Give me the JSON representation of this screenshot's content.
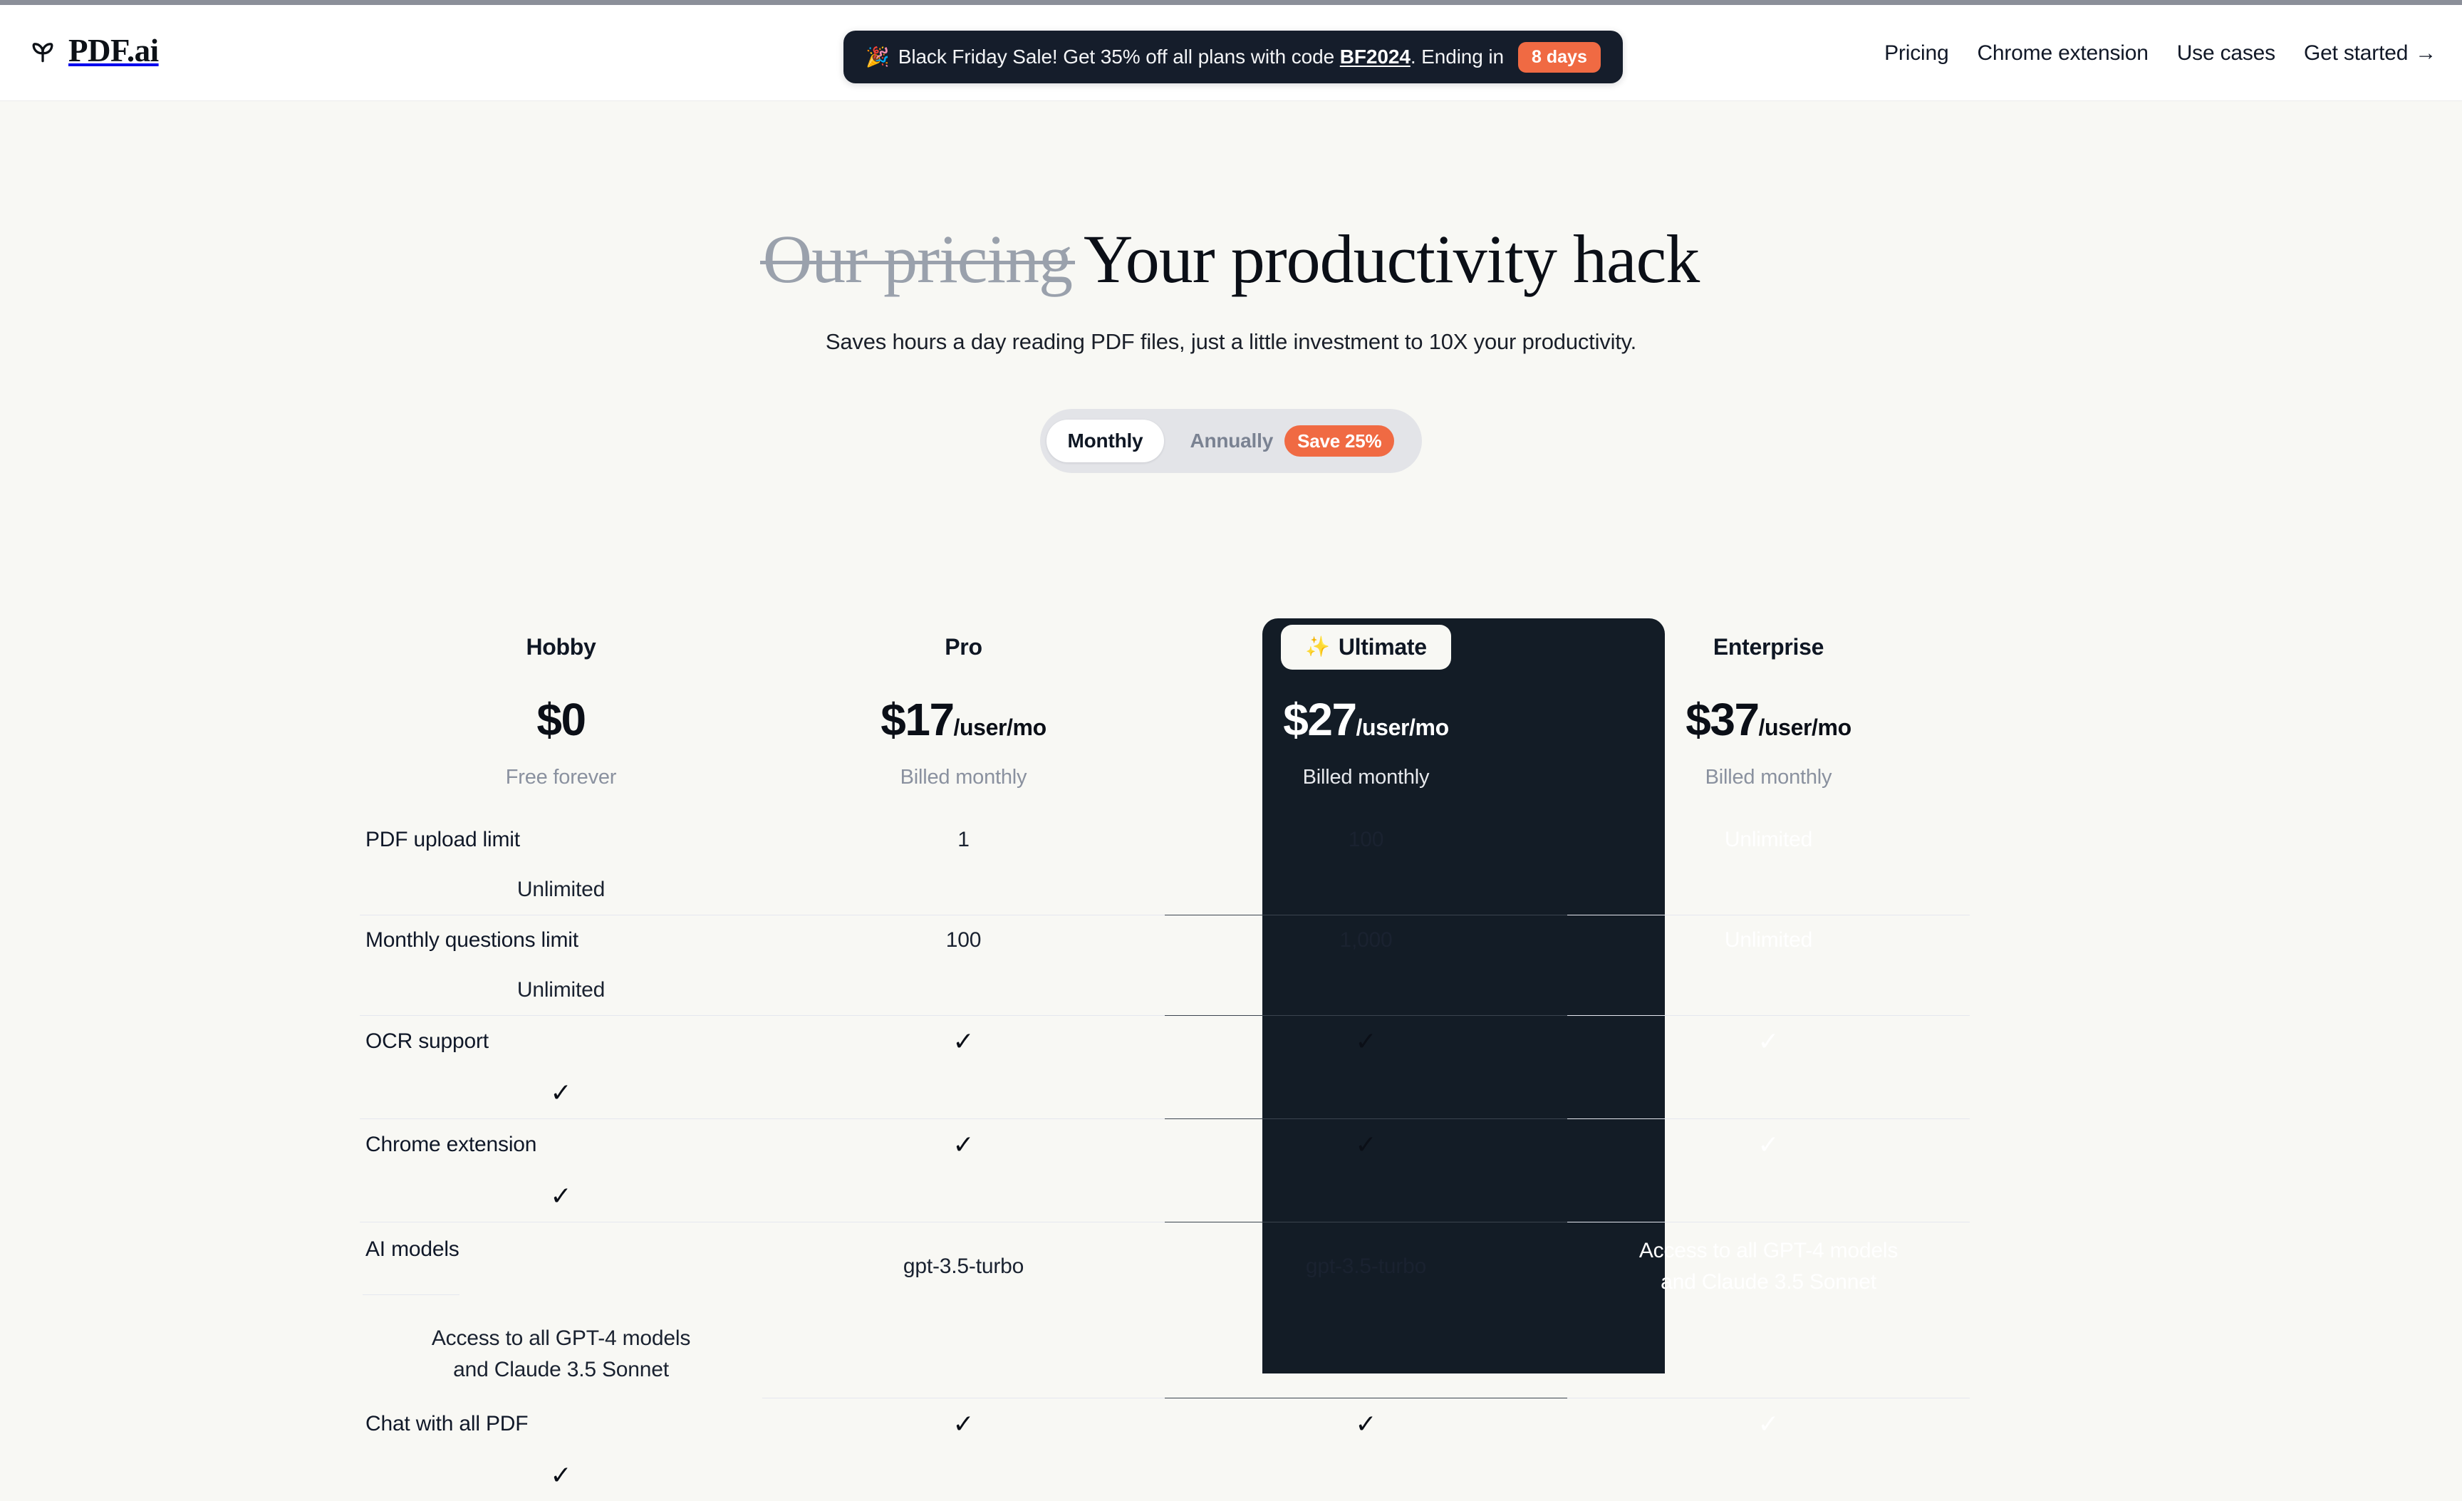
{
  "brand": {
    "name": "PDF.ai",
    "logo_icon": "sprout-icon"
  },
  "promo": {
    "emoji": "🎉",
    "text_before_code": "Black Friday Sale! Get 35% off all plans with code ",
    "code": "BF2024",
    "text_after_code": ". Ending in",
    "badge": "8 days"
  },
  "nav": {
    "links": [
      {
        "label": "Pricing"
      },
      {
        "label": "Chrome extension"
      },
      {
        "label": "Use cases"
      }
    ],
    "cta": {
      "label": "Get started",
      "arrow": "→"
    }
  },
  "hero": {
    "strikethrough": "Our pricing",
    "title": "Your productivity hack",
    "subtitle": "Saves hours a day reading PDF files, just a little investment to 10X your productivity."
  },
  "billing_toggle": {
    "monthly": "Monthly",
    "annually": "Annually",
    "save_badge": "Save 25%",
    "selected": "Monthly"
  },
  "colors": {
    "accent_orange": "#f06a43",
    "page_background": "#f8f8f4",
    "highlight_card": "#131c26",
    "muted_text": "#8a919f"
  },
  "pricing": {
    "plans": [
      {
        "name": "Hobby",
        "badge": null,
        "price": "$0",
        "per": "",
        "billing_note": "Free forever",
        "highlighted": false
      },
      {
        "name": "Pro",
        "badge": null,
        "price": "$17",
        "per": "/user/mo",
        "billing_note": "Billed monthly",
        "highlighted": false
      },
      {
        "name": "Ultimate",
        "badge": "Ultimate",
        "badge_icon": "sparkles-icon",
        "price": "$27",
        "per": "/user/mo",
        "billing_note": "Billed monthly",
        "highlighted": true
      },
      {
        "name": "Enterprise",
        "badge": null,
        "price": "$37",
        "per": "/user/mo",
        "billing_note": "Billed monthly",
        "highlighted": false
      }
    ],
    "features": [
      {
        "label": "PDF upload limit",
        "values": [
          "1",
          "100",
          "Unlimited",
          "Unlimited"
        ],
        "types": [
          "text",
          "text",
          "text",
          "text"
        ]
      },
      {
        "label": "Monthly questions limit",
        "values": [
          "100",
          "1,000",
          "Unlimited",
          "Unlimited"
        ],
        "types": [
          "text",
          "text",
          "text",
          "text"
        ]
      },
      {
        "label": "OCR support",
        "values": [
          "✓",
          "✓",
          "✓",
          "✓"
        ],
        "types": [
          "check",
          "check",
          "check",
          "check"
        ]
      },
      {
        "label": "Chrome extension",
        "values": [
          "✓",
          "✓",
          "✓",
          "✓"
        ],
        "types": [
          "check",
          "check",
          "check",
          "check"
        ]
      },
      {
        "label": "AI models",
        "values": [
          "gpt-3.5-turbo",
          "gpt-3.5-turbo",
          "Access to all GPT-4 models and Claude 3.5 Sonnet",
          "Access to all GPT-4 models and Claude 3.5 Sonnet"
        ],
        "types": [
          "text",
          "text",
          "text",
          "text"
        ]
      },
      {
        "label": "Chat with all PDF",
        "values": [
          "✓",
          "✓",
          "✓",
          "✓"
        ],
        "types": [
          "check",
          "check",
          "check",
          "check"
        ]
      }
    ]
  }
}
